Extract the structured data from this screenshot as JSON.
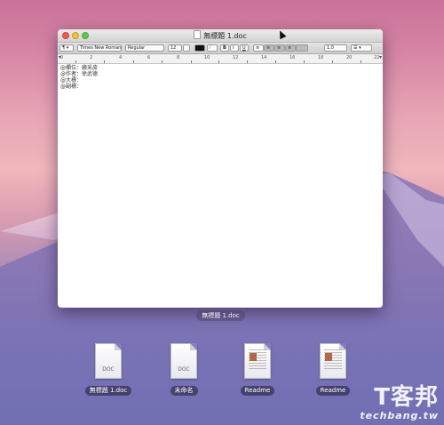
{
  "window": {
    "title": "無標題 1.doc",
    "label": "無標題 1.doc"
  },
  "toolbar": {
    "list_style": "¶ ▾",
    "font_family": "Times New Roman",
    "font_style": "Regular",
    "font_size": "12",
    "bold": "B",
    "italic": "I",
    "underline": "U",
    "line_spacing": "1.0",
    "list": "☰ ▾"
  },
  "ruler": {
    "numbers": [
      "0",
      "2",
      "4",
      "6",
      "8",
      "10",
      "12",
      "14",
      "16",
      "18",
      "20",
      "22"
    ]
  },
  "document": {
    "lines": [
      "@欄位：廠采皮",
      "@作者：徐武德",
      "@大標：",
      "@副標："
    ]
  },
  "desktop_files": [
    {
      "name": "無標題 1.doc",
      "ext": "DOC",
      "kind": "doc"
    },
    {
      "name": "未命名",
      "ext": "DOC",
      "kind": "doc"
    },
    {
      "name": "Readme",
      "ext": "",
      "kind": "rtfd"
    },
    {
      "name": "Readme",
      "ext": "",
      "kind": "rtfd"
    }
  ],
  "watermark": {
    "cn": "T客邦",
    "en": "techbang.tw"
  },
  "colors": {
    "close": "#ee5b52",
    "minimize": "#f4bd3b",
    "maximize": "#62c654"
  }
}
